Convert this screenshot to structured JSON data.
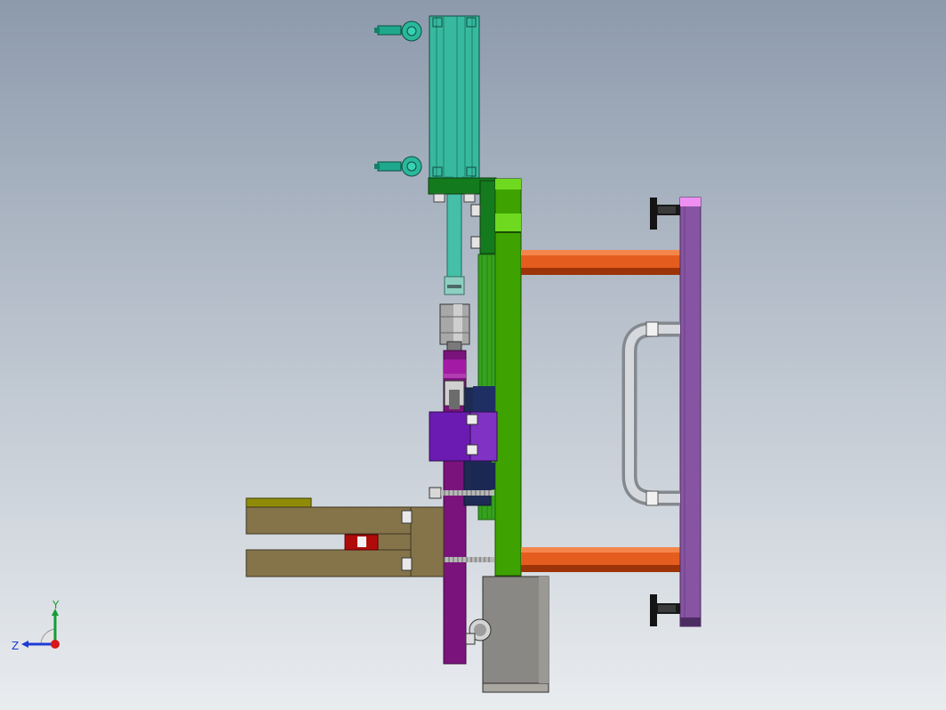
{
  "viewport": {
    "background_top": "#8d9aac",
    "background_bottom": "#e9ecef"
  },
  "colors": {
    "cylinder": "#37b99f",
    "cylinder_dark": "#1d7e6a",
    "fitting": "#1fa88c",
    "mount_green_dark": "#137b1d",
    "plate_green": "#3ea300",
    "plate_green_light": "#6ed91f",
    "rod_orange": "#e45d1f",
    "rod_orange_dark": "#9d3409",
    "handle_plate": "#8754a3",
    "handle_plate_top": "#f08ff2",
    "handle_tube": "#c2c7cc",
    "purple": "#7a137b",
    "violet": "#6b1bb2",
    "navy": "#1d2b55",
    "gripper_brown": "#85744a",
    "gripper_top": "#8f8b09",
    "red_part": "#b00b0b",
    "gray_box": "#8a8884",
    "knob_black": "#141414"
  },
  "triad": {
    "y_label": "Y",
    "z_label": "Z",
    "icon": "coordinate-triad-icon"
  }
}
